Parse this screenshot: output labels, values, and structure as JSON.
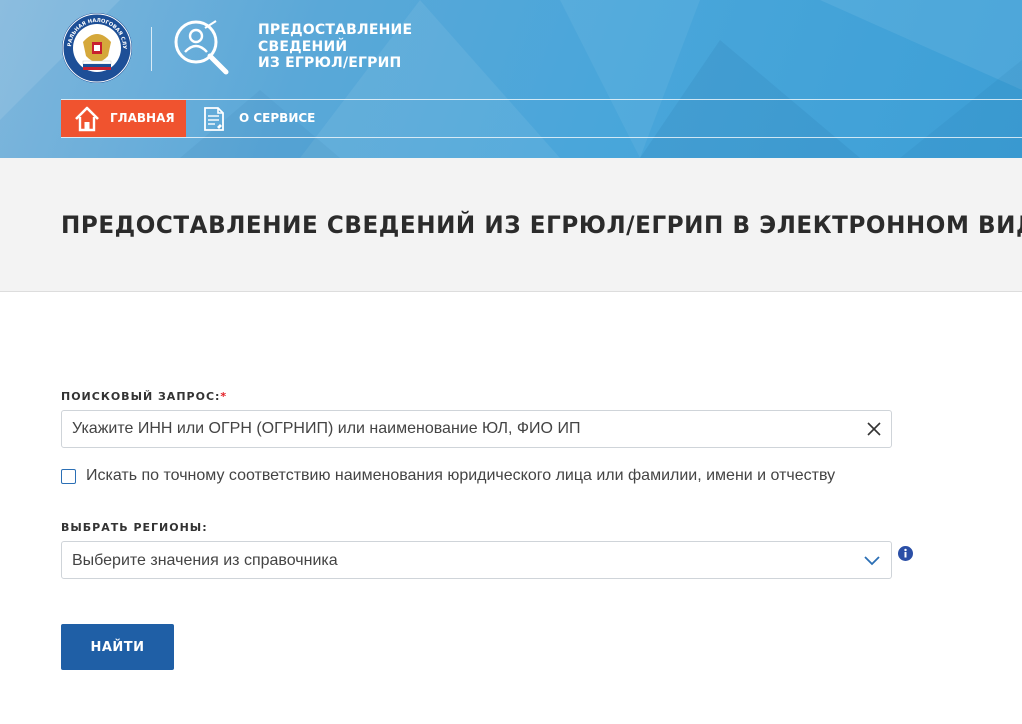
{
  "header": {
    "logo_alt": "ФЕДЕРАЛЬНАЯ НАЛОГОВАЯ СЛУЖБА",
    "service_title_lines": [
      "ПРЕДОСТАВЛЕНИЕ",
      "СВЕДЕНИЙ",
      "ИЗ ЕГРЮЛ/ЕГРИП"
    ],
    "nav": [
      {
        "label": "ГЛАВНАЯ",
        "icon": "home-icon",
        "active": true
      },
      {
        "label": "О СЕРВИСЕ",
        "icon": "document-icon",
        "active": false
      }
    ]
  },
  "page": {
    "title": "ПРЕДОСТАВЛЕНИЕ СВЕДЕНИЙ ИЗ ЕГРЮЛ/ЕГРИП В ЭЛЕКТРОННОМ ВИДЕ"
  },
  "form": {
    "query_label": "ПОИСКОВЫЙ ЗАПРОС:",
    "required_mark": "*",
    "query_placeholder": "Укажите ИНН или ОГРН (ОГРНИП) или наименование ЮЛ, ФИО ИП",
    "query_value": "",
    "exact_match_label": "Искать по точному соответствию наименования юридического лица или фамилии, имени и отчеству",
    "exact_match_checked": false,
    "region_label": "ВЫБРАТЬ РЕГИОНЫ:",
    "region_placeholder": "Выберите значения из справочника",
    "submit_label": "НАЙТИ"
  },
  "colors": {
    "header_blue": "#49a6da",
    "nav_active": "#f0532f",
    "button_blue": "#1f5fa6",
    "required_red": "#e31e24"
  }
}
